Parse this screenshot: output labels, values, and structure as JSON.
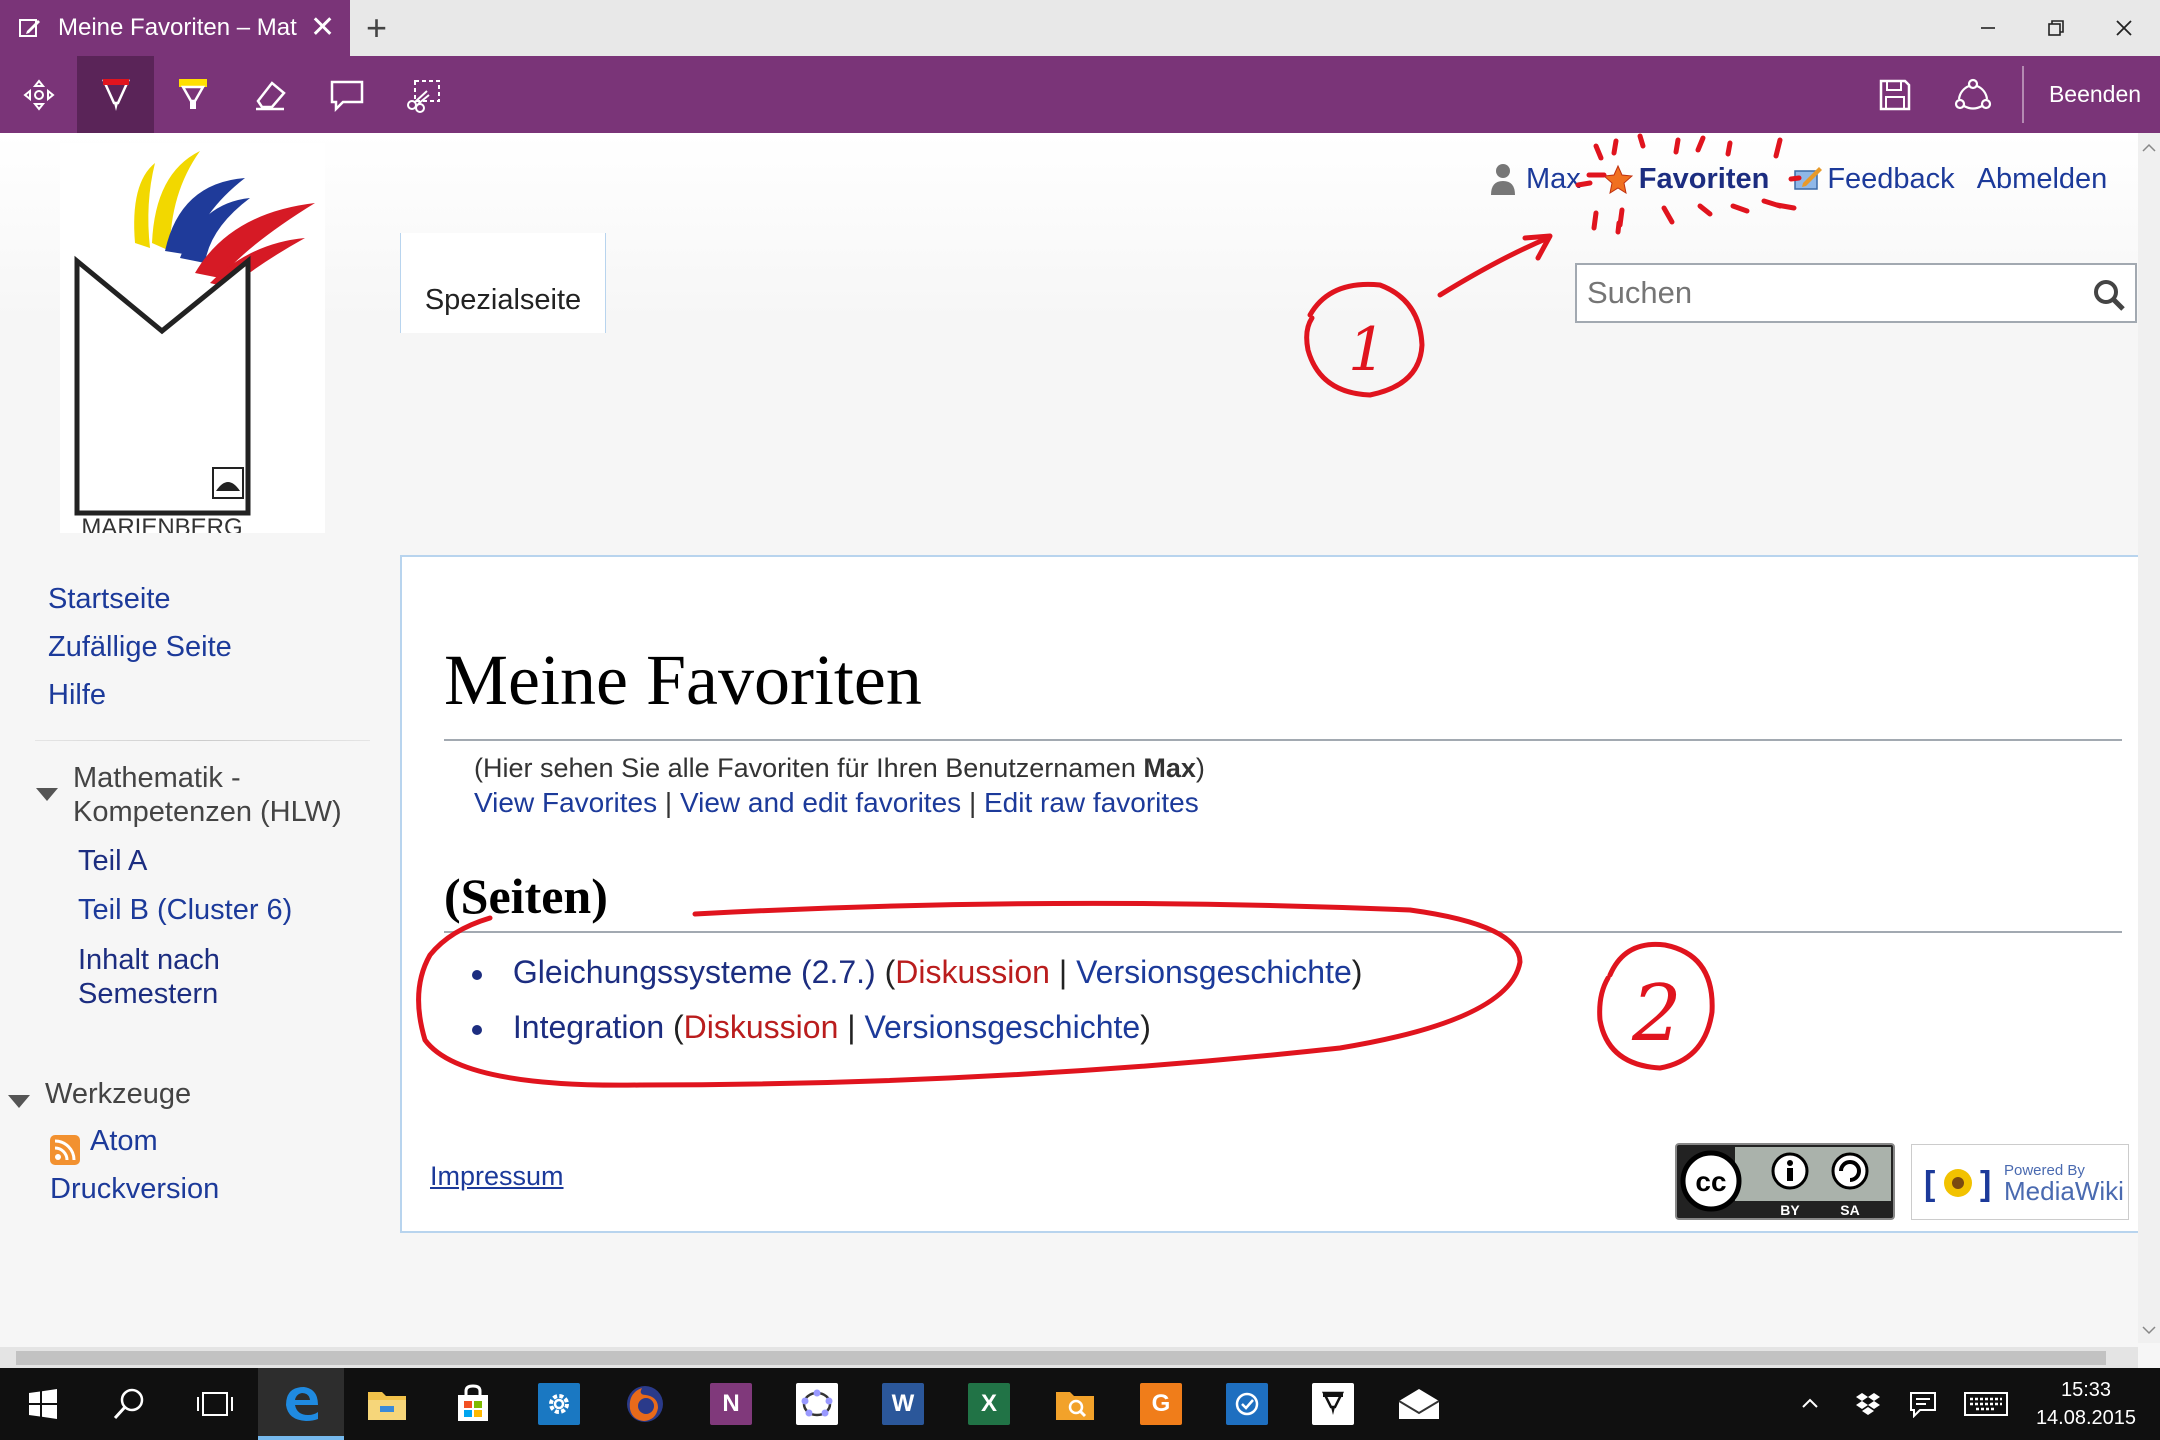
{
  "browser": {
    "tab_title": "Meine Favoriten – Matur",
    "close_glyph": "✕",
    "new_tab_glyph": "+"
  },
  "notebar": {
    "exit_label": "Beenden",
    "tools": [
      "pan-icon",
      "pen-icon",
      "highlighter-icon",
      "eraser-icon",
      "comment-icon",
      "clip-icon"
    ],
    "accent": "#7a3478"
  },
  "site": {
    "logo_text": "MARIENBERG",
    "user_links": {
      "user": "Max",
      "favorites": "Favoriten",
      "feedback": "Feedback",
      "logout": "Abmelden"
    },
    "special_tab": "Spezialseite",
    "search_placeholder": "Suchen"
  },
  "sidebar": {
    "nav": [
      "Startseite",
      "Zufällige Seite",
      "Hilfe"
    ],
    "math_heading": "Mathematik - Kompetenzen (HLW)",
    "math_items": [
      "Teil A",
      "Teil B (Cluster 6)",
      "Inhalt nach Semestern"
    ],
    "tools_heading": "Werkzeuge",
    "tools_items": [
      "Atom",
      "Druckversion"
    ]
  },
  "content": {
    "title": "Meine Favoriten",
    "intro_text": "(Hier sehen Sie alle Favoriten für Ihren Benutzernamen ",
    "intro_user": "Max",
    "intro_close": ")",
    "view_favorites": "View Favorites",
    "view_edit": "View and edit favorites",
    "edit_raw": "Edit raw favorites",
    "separator": "|",
    "section_title": "(Seiten)",
    "favorites": [
      {
        "page": "Gleichungssysteme (2.7.)",
        "talk": "Diskussion",
        "history": "Versionsgeschichte"
      },
      {
        "page": "Integration",
        "talk": "Diskussion",
        "history": "Versionsgeschichte"
      }
    ],
    "open_paren": "(",
    "close_paren": ")"
  },
  "footer": {
    "impressum": "Impressum",
    "cc_by": "BY",
    "cc_sa": "SA",
    "mw_powered": "Powered By",
    "mw_name": "MediaWiki"
  },
  "annotations": {
    "mark_1": "1",
    "mark_2": "2",
    "ink_color": "#e0141e"
  },
  "taskbar": {
    "time": "15:33",
    "date": "14.08.2015"
  }
}
